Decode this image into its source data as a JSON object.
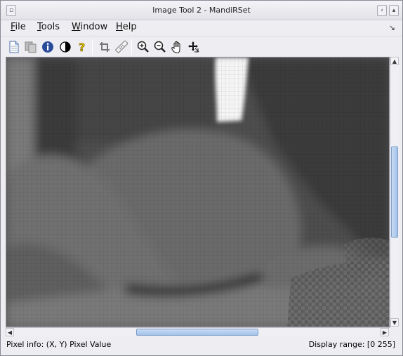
{
  "window": {
    "title": "Image Tool 2 - MandiRSet"
  },
  "menubar": {
    "items": [
      {
        "label": "File",
        "mnemonic": "F",
        "rest": "ile"
      },
      {
        "label": "Tools",
        "mnemonic": "T",
        "rest": "ools"
      },
      {
        "label": "Window",
        "mnemonic": "W",
        "rest": "indow"
      },
      {
        "label": "Help",
        "mnemonic": "H",
        "rest": "elp"
      }
    ]
  },
  "toolbar": {
    "tools": [
      {
        "name": "new-document-icon"
      },
      {
        "name": "copy-document-icon"
      },
      {
        "name": "info-icon"
      },
      {
        "name": "contrast-icon"
      },
      {
        "name": "help-icon"
      },
      {
        "name": "crop-icon"
      },
      {
        "name": "ruler-icon"
      },
      {
        "name": "zoom-in-icon"
      },
      {
        "name": "zoom-out-icon"
      },
      {
        "name": "pan-hand-icon"
      },
      {
        "name": "move-icon"
      }
    ]
  },
  "statusbar": {
    "pixel_info": "Pixel info: (X, Y)  Pixel Value",
    "display_range": "Display range: [0 255]"
  },
  "colors": {
    "scroll_thumb": "#a4c2ea",
    "window_bg": "#eeeef2"
  }
}
